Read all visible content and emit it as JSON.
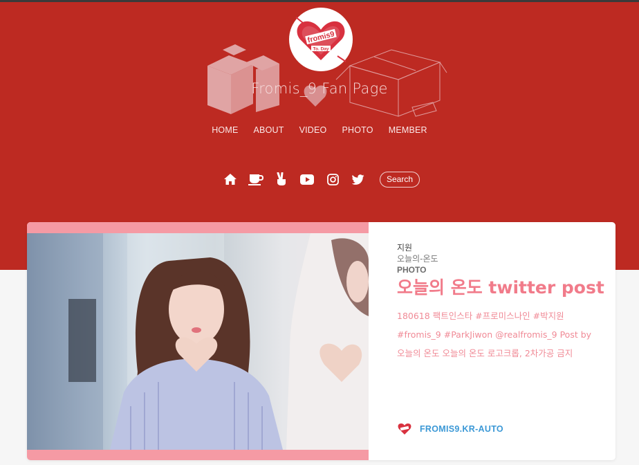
{
  "site": {
    "title": "Fromis_9 Fan Page",
    "logo_icon": "fromis9-heart-logo-icon",
    "logo_text": "fromis9",
    "logo_sub": "To. Day"
  },
  "nav": {
    "items": [
      "HOME",
      "ABOUT",
      "VIDEO",
      "PHOTO",
      "MEMBER"
    ]
  },
  "social": {
    "icons": [
      "home-icon",
      "coffee-cup-icon",
      "peace-hand-icon",
      "youtube-icon",
      "instagram-icon",
      "twitter-icon"
    ],
    "search_label": "Search"
  },
  "post": {
    "tag1": "지원",
    "tag2": "오늘의-온도",
    "category": "PHOTO",
    "title": "오늘의 온도 twitter post",
    "excerpt": "180618 팩트인스타 #프로미스나인 #박지원 #fromis_9 #ParkJiwon @realfromis_9 Post by 오늘의 온도 오늘의 온도 로고크롭, 2차가공 금지",
    "author": "FROMIS9.KR-AUTO"
  },
  "colors": {
    "hero_bg": "#bd2a22",
    "accent_pink": "#f17b8a",
    "link_blue": "#3b98d6"
  }
}
